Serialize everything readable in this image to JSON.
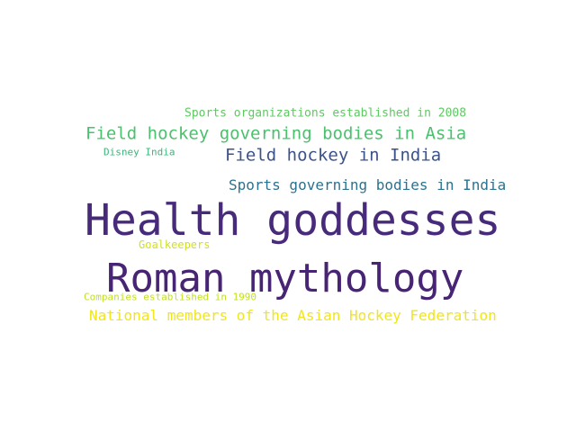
{
  "words": [
    {
      "text": "Health goddesses",
      "color": "#472a7a"
    },
    {
      "text": "Roman mythology",
      "color": "#482475"
    },
    {
      "text": "Field hockey governing bodies in Asia",
      "color": "#4ac16d"
    },
    {
      "text": "Field hockey in India",
      "color": "#3b528b"
    },
    {
      "text": "Sports governing bodies in India",
      "color": "#2c728e"
    },
    {
      "text": "National members of the Asian Hockey Federation",
      "color": "#f1e51d"
    },
    {
      "text": "Sports organizations established in 2008",
      "color": "#5ec962"
    },
    {
      "text": "Disney India",
      "color": "#35b779"
    },
    {
      "text": "Goalkeepers",
      "color": "#d0e11c"
    },
    {
      "text": "Companies established in 1990",
      "color": "#c2df23"
    }
  ]
}
